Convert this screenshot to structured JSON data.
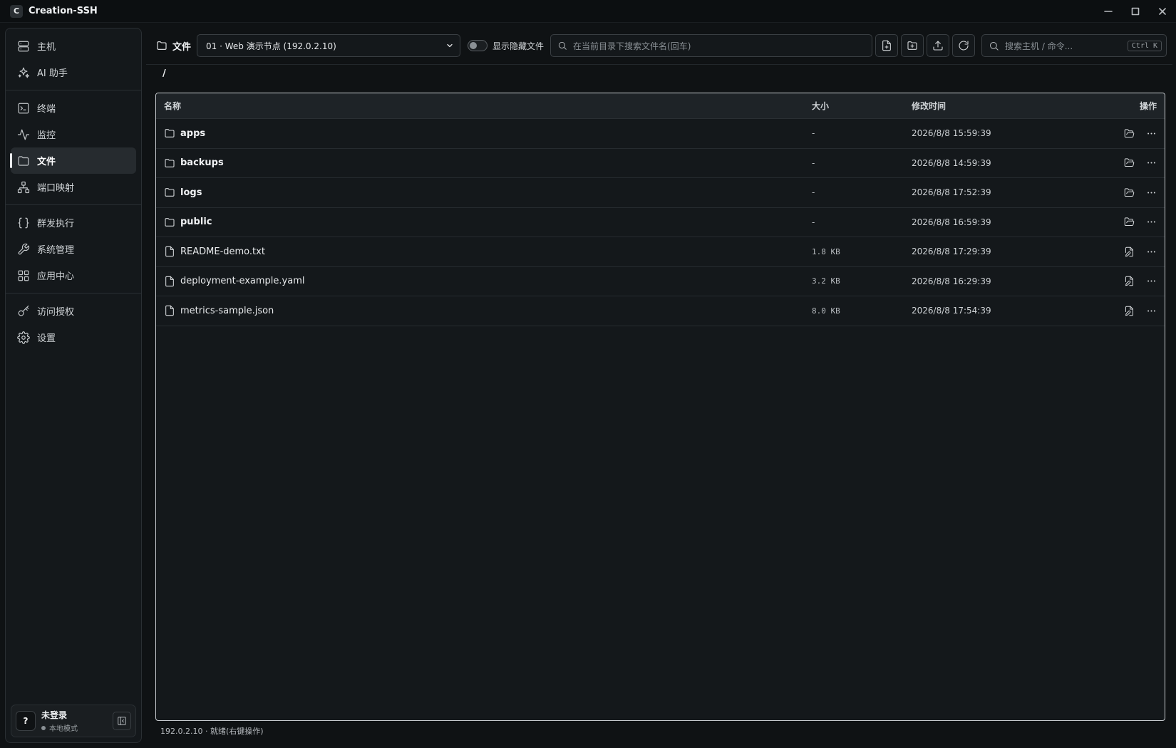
{
  "app": {
    "title": "Creation-SSH",
    "logo_letter": "C"
  },
  "sidebar": {
    "groups": [
      [
        {
          "label": "主机",
          "icon": "server-icon"
        },
        {
          "label": "AI 助手",
          "icon": "sparkles-icon"
        }
      ],
      [
        {
          "label": "终端",
          "icon": "terminal-icon"
        },
        {
          "label": "监控",
          "icon": "activity-icon"
        },
        {
          "label": "文件",
          "icon": "folder-icon",
          "active": true
        },
        {
          "label": "端口映射",
          "icon": "network-icon"
        }
      ],
      [
        {
          "label": "群发执行",
          "icon": "braces-icon"
        },
        {
          "label": "系统管理",
          "icon": "wrench-icon"
        },
        {
          "label": "应用中心",
          "icon": "grid-icon"
        }
      ],
      [
        {
          "label": "访问授权",
          "icon": "key-icon"
        },
        {
          "label": "设置",
          "icon": "gear-icon"
        }
      ]
    ],
    "user": {
      "avatar": "?",
      "name": "未登录",
      "mode": "本地模式"
    }
  },
  "toolbar": {
    "title": "文件",
    "host_select": "01 · Web 演示节点 (192.0.2.10)",
    "show_hidden_label": "显示隐藏文件",
    "show_hidden": false,
    "search_placeholder": "在当前目录下搜索文件名(回车)",
    "global_search_placeholder": "搜索主机 / 命令...",
    "global_search_shortcut": "Ctrl K"
  },
  "breadcrumb": "/",
  "table": {
    "headers": {
      "name": "名称",
      "size": "大小",
      "time": "修改时间",
      "actions": "操作"
    },
    "rows": [
      {
        "type": "folder",
        "name": "apps",
        "size": "-",
        "time": "2026/8/8 15:59:39"
      },
      {
        "type": "folder",
        "name": "backups",
        "size": "-",
        "time": "2026/8/8 14:59:39"
      },
      {
        "type": "folder",
        "name": "logs",
        "size": "-",
        "time": "2026/8/8 17:52:39"
      },
      {
        "type": "folder",
        "name": "public",
        "size": "-",
        "time": "2026/8/8 16:59:39"
      },
      {
        "type": "file",
        "name": "README-demo.txt",
        "size": "1.8 KB",
        "time": "2026/8/8 17:29:39"
      },
      {
        "type": "file",
        "name": "deployment-example.yaml",
        "size": "3.2 KB",
        "time": "2026/8/8 16:29:39"
      },
      {
        "type": "file",
        "name": "metrics-sample.json",
        "size": "8.0 KB",
        "time": "2026/8/8 17:54:39"
      }
    ]
  },
  "status": "192.0.2.10 · 就绪(右键操作)"
}
